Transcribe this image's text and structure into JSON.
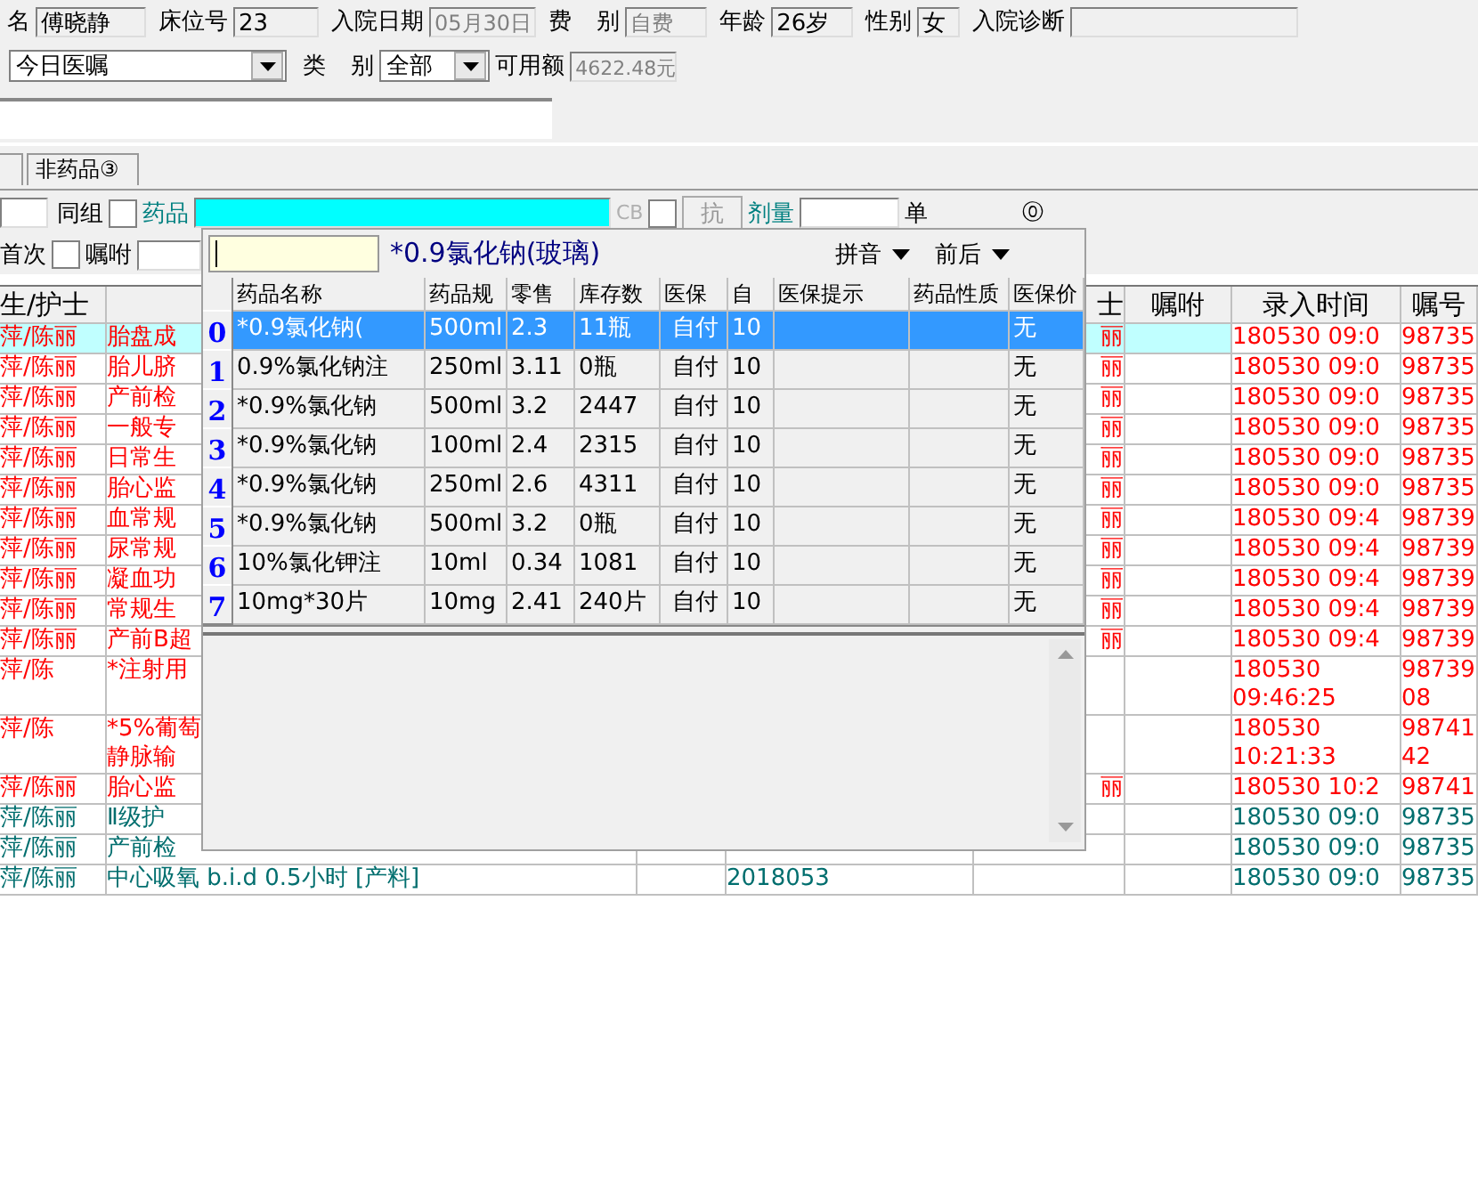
{
  "info_fields": [
    {
      "label": "名",
      "value": "傅晓静",
      "readonly": false
    },
    {
      "label": "床位号",
      "value": "23",
      "readonly": false
    },
    {
      "label": "入院日期",
      "value": "05月30日",
      "readonly": true
    },
    {
      "label": "费 别",
      "value": "自费",
      "readonly": true
    },
    {
      "label": "年龄",
      "value": "26岁",
      "readonly": false
    },
    {
      "label": "性别",
      "value": "女",
      "readonly": false
    },
    {
      "label": "入院诊断"
    }
  ],
  "filter": {
    "status_select": "今日医嘱",
    "category_label": "类 别",
    "category_select": "全部",
    "balance_label": "可用额",
    "balance": "4622.48元"
  },
  "tabs": [
    {
      "label": "非药品③"
    }
  ],
  "entry": {
    "group_label": "同组",
    "group_checked": false,
    "drug_label": "药品",
    "cb_label": "CB",
    "cb_checked": false,
    "anti_button": "抗",
    "dose_label": "剂量",
    "unit_label": "单",
    "count": "⓪",
    "first_label": "首次",
    "first_checked": false,
    "note_label": "嘱咐"
  },
  "orders": {
    "header": {
      "doctor": "生/护士",
      "nurse": "士",
      "note": "嘱咐",
      "time": "录入时间",
      "number": "嘱号"
    },
    "rows": [
      {
        "doctor": "萍/陈丽",
        "content": "胎盘成",
        "nurse": "丽",
        "time": "180530 09:0",
        "number": "98735",
        "color": "#ff0000",
        "selected": true
      },
      {
        "doctor": "萍/陈丽",
        "content": "胎儿脐",
        "nurse": "丽",
        "time": "180530 09:0",
        "number": "98735",
        "color": "#ff0000",
        "selected": false
      },
      {
        "doctor": "萍/陈丽",
        "content": "产前检",
        "nurse": "丽",
        "time": "180530 09:0",
        "number": "98735",
        "color": "#ff0000",
        "selected": false
      },
      {
        "doctor": "萍/陈丽",
        "content": "一般专",
        "nurse": "丽",
        "time": "180530 09:0",
        "number": "98735",
        "color": "#ff0000",
        "selected": false
      },
      {
        "doctor": "萍/陈丽",
        "content": "日常生",
        "nurse": "丽",
        "time": "180530 09:0",
        "number": "98735",
        "color": "#ff0000",
        "selected": false
      },
      {
        "doctor": "萍/陈丽",
        "content": "胎心监",
        "nurse": "丽",
        "time": "180530 09:0",
        "number": "98735",
        "color": "#ff0000",
        "selected": false
      },
      {
        "doctor": "萍/陈丽",
        "content": "血常规",
        "nurse": "丽",
        "time": "180530 09:4",
        "number": "98739",
        "color": "#ff0000",
        "selected": false
      },
      {
        "doctor": "萍/陈丽",
        "content": "尿常规",
        "nurse": "丽",
        "time": "180530 09:4",
        "number": "98739",
        "color": "#ff0000",
        "selected": false
      },
      {
        "doctor": "萍/陈丽",
        "content": "凝血功",
        "nurse": "丽",
        "time": "180530 09:4",
        "number": "98739",
        "color": "#ff0000",
        "selected": false
      },
      {
        "doctor": "萍/陈丽",
        "content": "常规生",
        "nurse": "丽",
        "time": "180530 09:4",
        "number": "98739",
        "color": "#ff0000",
        "selected": false
      },
      {
        "doctor": "萍/陈丽",
        "content": "产前B超",
        "nurse": "丽",
        "time": "180530 09:4",
        "number": "98739",
        "color": "#ff0000",
        "selected": false
      },
      {
        "doctor": "萍/陈",
        "content": "*注射用",
        "time": "180530\n09:46:25",
        "number": "98739\n08",
        "color": "#ff0000",
        "selected": false
      },
      {
        "doctor": "萍/陈",
        "content": "*5%葡萄",
        "content_2": "静脉输",
        "time": "180530\n10:21:33",
        "number": "98741\n42",
        "color": "#ff0000",
        "selected": false
      },
      {
        "doctor": "萍/陈丽",
        "content": "胎心监",
        "nurse": "丽",
        "time": "180530 10:2",
        "number": "98741",
        "color": "#ff0000",
        "selected": false
      },
      {
        "doctor": "萍/陈丽",
        "content": "Ⅱ级护",
        "time": "180530 09:0",
        "number": "98735",
        "color": "#006e6e",
        "selected": false
      },
      {
        "doctor": "萍/陈丽",
        "content": "产前检",
        "time": "180530 09:0",
        "number": "98735",
        "color": "#006e6e",
        "selected": false
      },
      {
        "doctor": "萍/陈丽",
        "content": "中心吸氧 b.i.d 0.5小时 [产料]",
        "date": "2018053",
        "time": "180530 09:0",
        "number": "98735",
        "color": "#006e6e",
        "selected": false
      }
    ]
  },
  "picker": {
    "current": "*0.9氯化钠(玻璃)",
    "sort_1": "拼音",
    "sort_2": "前后",
    "columns": [
      "药品名称",
      "药品规",
      "零售",
      "库存数",
      "医保",
      "自",
      "医保提示",
      "药品性质",
      "医保价"
    ],
    "rows": [
      {
        "index": "0",
        "cells": [
          "*0.9氯化钠(",
          "500ml",
          "2.3",
          "11瓶",
          "自付",
          "10",
          "",
          "",
          "无"
        ],
        "selected": true
      },
      {
        "index": "1",
        "cells": [
          "0.9%氯化钠注",
          "250ml",
          "3.11",
          "0瓶",
          "自付",
          "10",
          "",
          "",
          "无"
        ],
        "selected": false
      },
      {
        "index": "2",
        "cells": [
          "*0.9%氯化钠",
          "500ml",
          "3.2",
          "2447",
          "自付",
          "10",
          "",
          "",
          "无"
        ],
        "selected": false
      },
      {
        "index": "3",
        "cells": [
          "*0.9%氯化钠",
          "100ml",
          "2.4",
          "2315",
          "自付",
          "10",
          "",
          "",
          "无"
        ],
        "selected": false
      },
      {
        "index": "4",
        "cells": [
          "*0.9%氯化钠",
          "250ml",
          "2.6",
          "4311",
          "自付",
          "10",
          "",
          "",
          "无"
        ],
        "selected": false
      },
      {
        "index": "5",
        "cells": [
          "*0.9%氯化钠",
          "500ml",
          "3.2",
          "0瓶",
          "自付",
          "10",
          "",
          "",
          "无"
        ],
        "selected": false
      },
      {
        "index": "6",
        "cells": [
          "10%氯化钾注",
          "10ml",
          "0.34",
          "1081",
          "自付",
          "10",
          "",
          "",
          "无"
        ],
        "selected": false
      },
      {
        "index": "7",
        "cells": [
          "10mg*30片",
          "10mg",
          "2.41",
          "240片",
          "自付",
          "10",
          "",
          "",
          "无"
        ],
        "selected": false
      }
    ]
  }
}
